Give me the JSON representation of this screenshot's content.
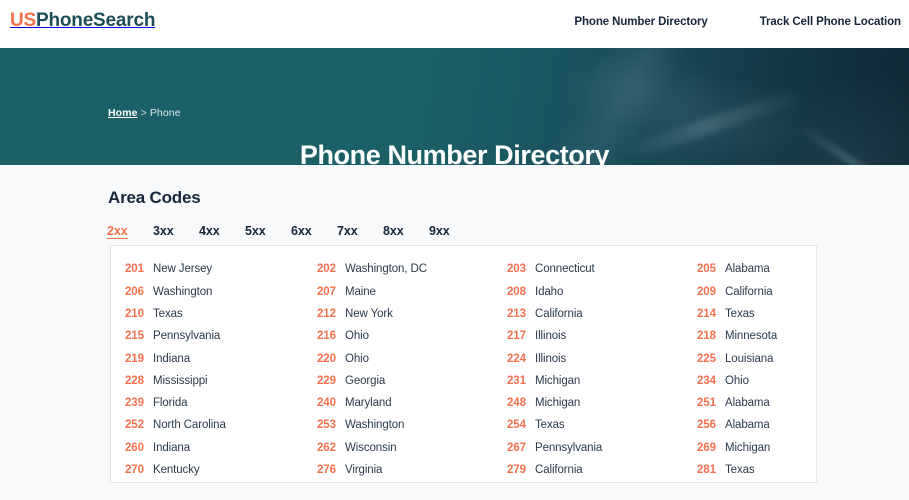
{
  "header": {
    "logo_prefix": "US",
    "logo_suffix": "PhoneSearch",
    "nav": [
      {
        "label": "Phone Number Directory"
      },
      {
        "label": "Track Cell Phone Location"
      }
    ]
  },
  "hero": {
    "breadcrumb_home": "Home",
    "breadcrumb_separator": ">",
    "breadcrumb_current": "Phone",
    "title": "Phone Number Directory"
  },
  "main": {
    "section_title": "Area Codes",
    "tabs": [
      {
        "label": "2xx",
        "active": true
      },
      {
        "label": "3xx",
        "active": false
      },
      {
        "label": "4xx",
        "active": false
      },
      {
        "label": "5xx",
        "active": false
      },
      {
        "label": "6xx",
        "active": false
      },
      {
        "label": "7xx",
        "active": false
      },
      {
        "label": "8xx",
        "active": false
      },
      {
        "label": "9xx",
        "active": false
      }
    ],
    "area_codes": [
      {
        "code": "201",
        "state": "New Jersey"
      },
      {
        "code": "206",
        "state": "Washington"
      },
      {
        "code": "210",
        "state": "Texas"
      },
      {
        "code": "215",
        "state": "Pennsylvania"
      },
      {
        "code": "219",
        "state": "Indiana"
      },
      {
        "code": "228",
        "state": "Mississippi"
      },
      {
        "code": "239",
        "state": "Florida"
      },
      {
        "code": "252",
        "state": "North Carolina"
      },
      {
        "code": "260",
        "state": "Indiana"
      },
      {
        "code": "270",
        "state": "Kentucky"
      },
      {
        "code": "202",
        "state": "Washington, DC"
      },
      {
        "code": "207",
        "state": "Maine"
      },
      {
        "code": "212",
        "state": "New York"
      },
      {
        "code": "216",
        "state": "Ohio"
      },
      {
        "code": "220",
        "state": "Ohio"
      },
      {
        "code": "229",
        "state": "Georgia"
      },
      {
        "code": "240",
        "state": "Maryland"
      },
      {
        "code": "253",
        "state": "Washington"
      },
      {
        "code": "262",
        "state": "Wisconsin"
      },
      {
        "code": "276",
        "state": "Virginia"
      },
      {
        "code": "203",
        "state": "Connecticut"
      },
      {
        "code": "208",
        "state": "Idaho"
      },
      {
        "code": "213",
        "state": "California"
      },
      {
        "code": "217",
        "state": "Illinois"
      },
      {
        "code": "224",
        "state": "Illinois"
      },
      {
        "code": "231",
        "state": "Michigan"
      },
      {
        "code": "248",
        "state": "Michigan"
      },
      {
        "code": "254",
        "state": "Texas"
      },
      {
        "code": "267",
        "state": "Pennsylvania"
      },
      {
        "code": "279",
        "state": "California"
      },
      {
        "code": "205",
        "state": "Alabama"
      },
      {
        "code": "209",
        "state": "California"
      },
      {
        "code": "214",
        "state": "Texas"
      },
      {
        "code": "218",
        "state": "Minnesota"
      },
      {
        "code": "225",
        "state": "Louisiana"
      },
      {
        "code": "234",
        "state": "Ohio"
      },
      {
        "code": "251",
        "state": "Alabama"
      },
      {
        "code": "256",
        "state": "Alabama"
      },
      {
        "code": "269",
        "state": "Michigan"
      },
      {
        "code": "281",
        "state": "Texas"
      }
    ]
  },
  "colors": {
    "accent_orange": "#f4714e",
    "dark_navy": "#17263a",
    "hero_teal": "#1b6067",
    "hero_dark": "#102733",
    "page_bg": "#f8f9fa"
  }
}
